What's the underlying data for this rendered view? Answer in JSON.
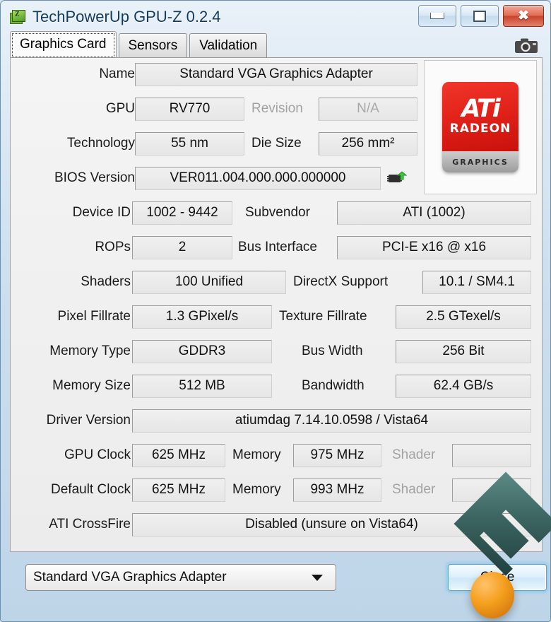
{
  "window": {
    "title": "TechPowerUp GPU-Z 0.2.4",
    "icon": "gpuz-logo-icon",
    "buttons": {
      "minimize": "minimize-icon",
      "maximize": "maximize-icon",
      "close": "close-icon"
    }
  },
  "tabs": [
    {
      "label": "Graphics Card",
      "active": true
    },
    {
      "label": "Sensors",
      "active": false
    },
    {
      "label": "Validation",
      "active": false
    }
  ],
  "toolbar": {
    "screenshot_icon": "camera-icon"
  },
  "fields": {
    "name_label": "Name",
    "name_value": "Standard VGA Graphics Adapter",
    "gpu_label": "GPU",
    "gpu_value": "RV770",
    "revision_label": "Revision",
    "revision_value": "N/A",
    "technology_label": "Technology",
    "technology_value": "55 nm",
    "die_size_label": "Die Size",
    "die_size_value": "256 mm²",
    "bios_label": "BIOS Version",
    "bios_value": "VER011.004.000.000.000000",
    "device_id_label": "Device ID",
    "device_id_value": "1002 - 9442",
    "subvendor_label": "Subvendor",
    "subvendor_value": "ATI (1002)",
    "rops_label": "ROPs",
    "rops_value": "2",
    "bus_interface_label": "Bus Interface",
    "bus_interface_value": "PCI-E x16 @ x16",
    "shaders_label": "Shaders",
    "shaders_value": "100 Unified",
    "directx_label": "DirectX Support",
    "directx_value": "10.1 / SM4.1",
    "pixel_fillrate_label": "Pixel Fillrate",
    "pixel_fillrate_value": "1.3 GPixel/s",
    "texture_fillrate_label": "Texture Fillrate",
    "texture_fillrate_value": "2.5 GTexel/s",
    "memory_type_label": "Memory Type",
    "memory_type_value": "GDDR3",
    "bus_width_label": "Bus Width",
    "bus_width_value": "256 Bit",
    "memory_size_label": "Memory Size",
    "memory_size_value": "512 MB",
    "bandwidth_label": "Bandwidth",
    "bandwidth_value": "62.4 GB/s",
    "driver_label": "Driver Version",
    "driver_value": "atiumdag 7.14.10.0598  / Vista64",
    "gpu_clock_label": "GPU Clock",
    "gpu_clock_value": "625 MHz",
    "gpu_memory_label": "Memory",
    "gpu_memory_value": "975 MHz",
    "gpu_shader_label": "Shader",
    "gpu_shader_value": "",
    "default_clock_label": "Default Clock",
    "default_clock_value": "625 MHz",
    "default_memory_label": "Memory",
    "default_memory_value": "993 MHz",
    "default_shader_label": "Shader",
    "default_shader_value": "",
    "crossfire_label": "ATI CrossFire",
    "crossfire_value": "Disabled (unsure on Vista64)"
  },
  "logo": {
    "brand": "ATi",
    "line2": "RADEON",
    "line3": "GRAPHICS"
  },
  "bottom": {
    "adapter_selected": "Standard VGA Graphics Adapter",
    "dropdown_icon": "chevron-down-icon",
    "close_label": "Close"
  },
  "overlay": {
    "watermark": "diamond-e-watermark",
    "sphere": "orange-sphere-overlay"
  },
  "colors": {
    "accent": "#c9110b",
    "titlebar": "#cfe0ef",
    "close_red": "#c9432c",
    "focus_blue": "#5aa7d8"
  }
}
